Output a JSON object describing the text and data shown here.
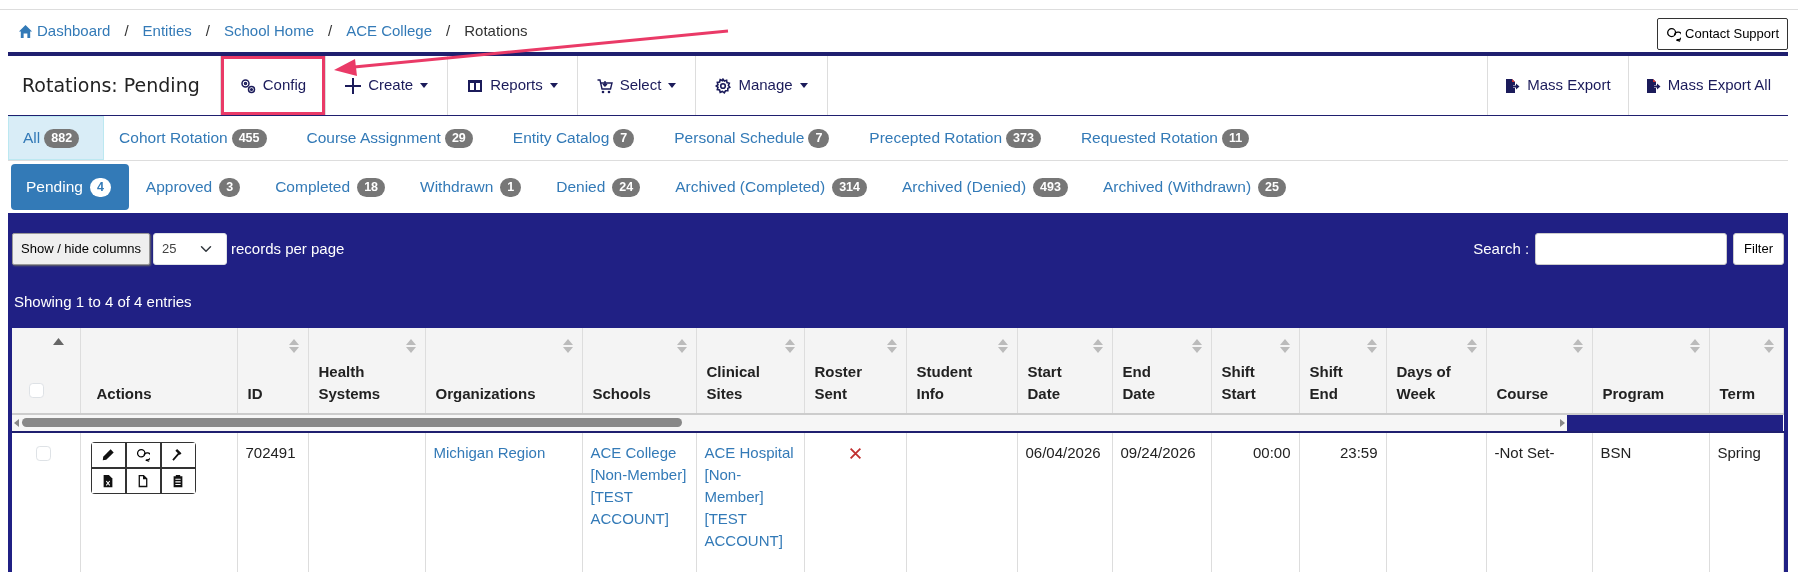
{
  "breadcrumb": {
    "separator": "/",
    "items": [
      {
        "label": "Dashboard",
        "kind": "home",
        "current": false
      },
      {
        "label": "Entities",
        "kind": "link",
        "current": false
      },
      {
        "label": "School Home",
        "kind": "link",
        "current": false
      },
      {
        "label": "ACE College",
        "kind": "link",
        "current": false
      },
      {
        "label": "Rotations",
        "kind": "link",
        "current": true
      }
    ]
  },
  "contact_button": "Contact Support",
  "toolbar": {
    "title": "Rotations: Pending",
    "items": [
      {
        "label": "Config",
        "kind": "config",
        "dropdown": false,
        "highlighted": true
      },
      {
        "label": "Create",
        "kind": "create",
        "dropdown": true,
        "highlighted": false
      },
      {
        "label": "Reports",
        "kind": "reports",
        "dropdown": true,
        "highlighted": false
      },
      {
        "label": "Select",
        "kind": "select",
        "dropdown": true,
        "highlighted": false
      },
      {
        "label": "Manage",
        "kind": "manage",
        "dropdown": true,
        "highlighted": false
      }
    ],
    "right_items": [
      {
        "label": "Mass Export",
        "kind": "export"
      },
      {
        "label": "Mass Export All",
        "kind": "export"
      }
    ]
  },
  "type_tabs": [
    {
      "label": "All",
      "count": "882",
      "selected": true
    },
    {
      "label": "Cohort Rotation",
      "count": "455",
      "selected": false
    },
    {
      "label": "Course Assignment",
      "count": "29",
      "selected": false
    },
    {
      "label": "Entity Catalog",
      "count": "7",
      "selected": false
    },
    {
      "label": "Personal Schedule",
      "count": "7",
      "selected": false
    },
    {
      "label": "Precepted Rotation",
      "count": "373",
      "selected": false
    },
    {
      "label": "Requested Rotation",
      "count": "11",
      "selected": false
    }
  ],
  "status_tabs": [
    {
      "label": "Pending",
      "count": "4",
      "selected": true
    },
    {
      "label": "Approved",
      "count": "3",
      "selected": false
    },
    {
      "label": "Completed",
      "count": "18",
      "selected": false
    },
    {
      "label": "Withdrawn",
      "count": "1",
      "selected": false
    },
    {
      "label": "Denied",
      "count": "24",
      "selected": false
    },
    {
      "label": "Archived (Completed)",
      "count": "314",
      "selected": false
    },
    {
      "label": "Archived (Denied)",
      "count": "493",
      "selected": false
    },
    {
      "label": "Archived (Withdrawn)",
      "count": "25",
      "selected": false
    }
  ],
  "table_controls": {
    "columns_button": "Show / hide columns",
    "page_size": "25",
    "page_size_label": "records per page",
    "search_label": "Search :",
    "filter_button": "Filter",
    "info": "Showing 1 to 4 of 4 entries"
  },
  "table": {
    "columns": [
      {
        "kind": "checkbox",
        "checked": false,
        "sortable": true,
        "sorted": true
      },
      {
        "kind": "label",
        "label": "Actions",
        "sortable": false
      },
      {
        "kind": "label",
        "label": "ID",
        "sortable": true,
        "sorted": false
      },
      {
        "kind": "label",
        "label": "Health Systems",
        "sortable": true,
        "sorted": false
      },
      {
        "kind": "label",
        "label": "Organizations",
        "sortable": true,
        "sorted": false
      },
      {
        "kind": "label",
        "label": "Schools",
        "sortable": true,
        "sorted": false
      },
      {
        "kind": "label",
        "label": "Clinical Sites",
        "sortable": true,
        "sorted": false
      },
      {
        "kind": "label",
        "label": "Roster Sent",
        "sortable": true,
        "sorted": false
      },
      {
        "kind": "label",
        "label": "Student Info",
        "sortable": true,
        "sorted": false
      },
      {
        "kind": "label",
        "label": "Start Date",
        "sortable": true,
        "sorted": false
      },
      {
        "kind": "label",
        "label": "End Date",
        "sortable": true,
        "sorted": false
      },
      {
        "kind": "label",
        "label": "Shift Start",
        "sortable": true,
        "sorted": false
      },
      {
        "kind": "label",
        "label": "Shift End",
        "sortable": true,
        "sorted": false
      },
      {
        "kind": "label",
        "label": "Days of Week",
        "sortable": true,
        "sorted": false
      },
      {
        "kind": "label",
        "label": "Course",
        "sortable": true,
        "sorted": false
      },
      {
        "kind": "label",
        "label": "Program",
        "sortable": true,
        "sorted": false
      },
      {
        "kind": "label",
        "label": "Term",
        "sortable": true,
        "sorted": false
      }
    ],
    "rows": [
      {
        "cells": [
          {
            "kind": "checkbox",
            "checked": false
          },
          {
            "kind": "actions",
            "actions": [
              {
                "kind": "edit"
              },
              {
                "kind": "comments"
              },
              {
                "kind": "gavel"
              },
              {
                "kind": "excel"
              },
              {
                "kind": "file"
              },
              {
                "kind": "clipboard"
              }
            ]
          },
          {
            "kind": "text",
            "text": "702491"
          },
          {
            "kind": "empty"
          },
          {
            "kind": "link",
            "text": "Michigan Region"
          },
          {
            "kind": "link",
            "text": "ACE College [Non-Member] [TEST ACCOUNT]"
          },
          {
            "kind": "link",
            "text": "ACE Hospital [Non-Member] [TEST ACCOUNT]"
          },
          {
            "kind": "flag",
            "on": false
          },
          {
            "kind": "empty"
          },
          {
            "kind": "text",
            "text": "06/04/2026"
          },
          {
            "kind": "text",
            "text": "09/24/2026"
          },
          {
            "kind": "time",
            "text": "00:00"
          },
          {
            "kind": "time",
            "text": "23:59"
          },
          {
            "kind": "empty"
          },
          {
            "kind": "text",
            "text": "-Not Set-"
          },
          {
            "kind": "text",
            "text": "BSN"
          },
          {
            "kind": "text",
            "text": "Spring"
          }
        ]
      }
    ]
  }
}
